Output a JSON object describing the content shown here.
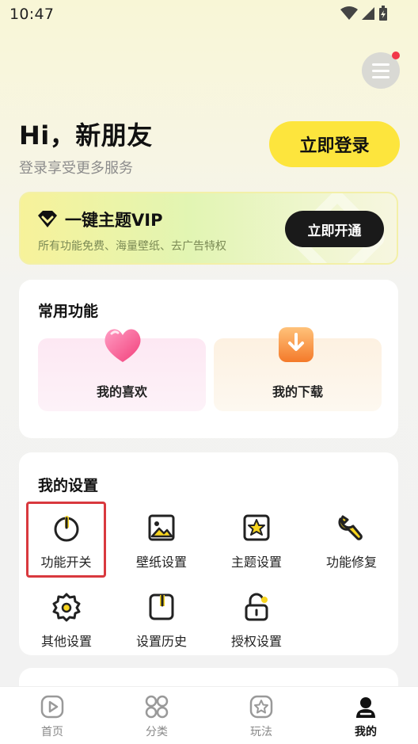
{
  "status_bar": {
    "time": "10:47"
  },
  "header": {
    "greeting": "Hi，新朋友",
    "subtitle": "登录享受更多服务",
    "login_label": "立即登录"
  },
  "vip": {
    "title": "一键主题VIP",
    "subtitle": "所有功能免费、海量壁纸、去广告特权",
    "button_label": "立即开通"
  },
  "common": {
    "title": "常用功能",
    "items": [
      {
        "label": "我的喜欢",
        "icon": "heart-icon"
      },
      {
        "label": "我的下载",
        "icon": "download-icon"
      }
    ]
  },
  "settings": {
    "title": "我的设置",
    "items": [
      {
        "label": "功能开关",
        "icon": "power-icon"
      },
      {
        "label": "壁纸设置",
        "icon": "image-icon"
      },
      {
        "label": "主题设置",
        "icon": "theme-icon"
      },
      {
        "label": "功能修复",
        "icon": "wrench-icon"
      },
      {
        "label": "其他设置",
        "icon": "gear-icon"
      },
      {
        "label": "设置历史",
        "icon": "history-icon"
      },
      {
        "label": "授权设置",
        "icon": "lock-icon"
      }
    ]
  },
  "bottom_nav": {
    "items": [
      {
        "label": "首页",
        "icon": "play-icon"
      },
      {
        "label": "分类",
        "icon": "grid-icon"
      },
      {
        "label": "玩法",
        "icon": "star-icon"
      },
      {
        "label": "我的",
        "icon": "user-icon"
      }
    ],
    "active_index": 3
  },
  "colors": {
    "accent_yellow": "#fde53d",
    "highlight_red": "#d9393e",
    "badge_red": "#f2384a"
  }
}
